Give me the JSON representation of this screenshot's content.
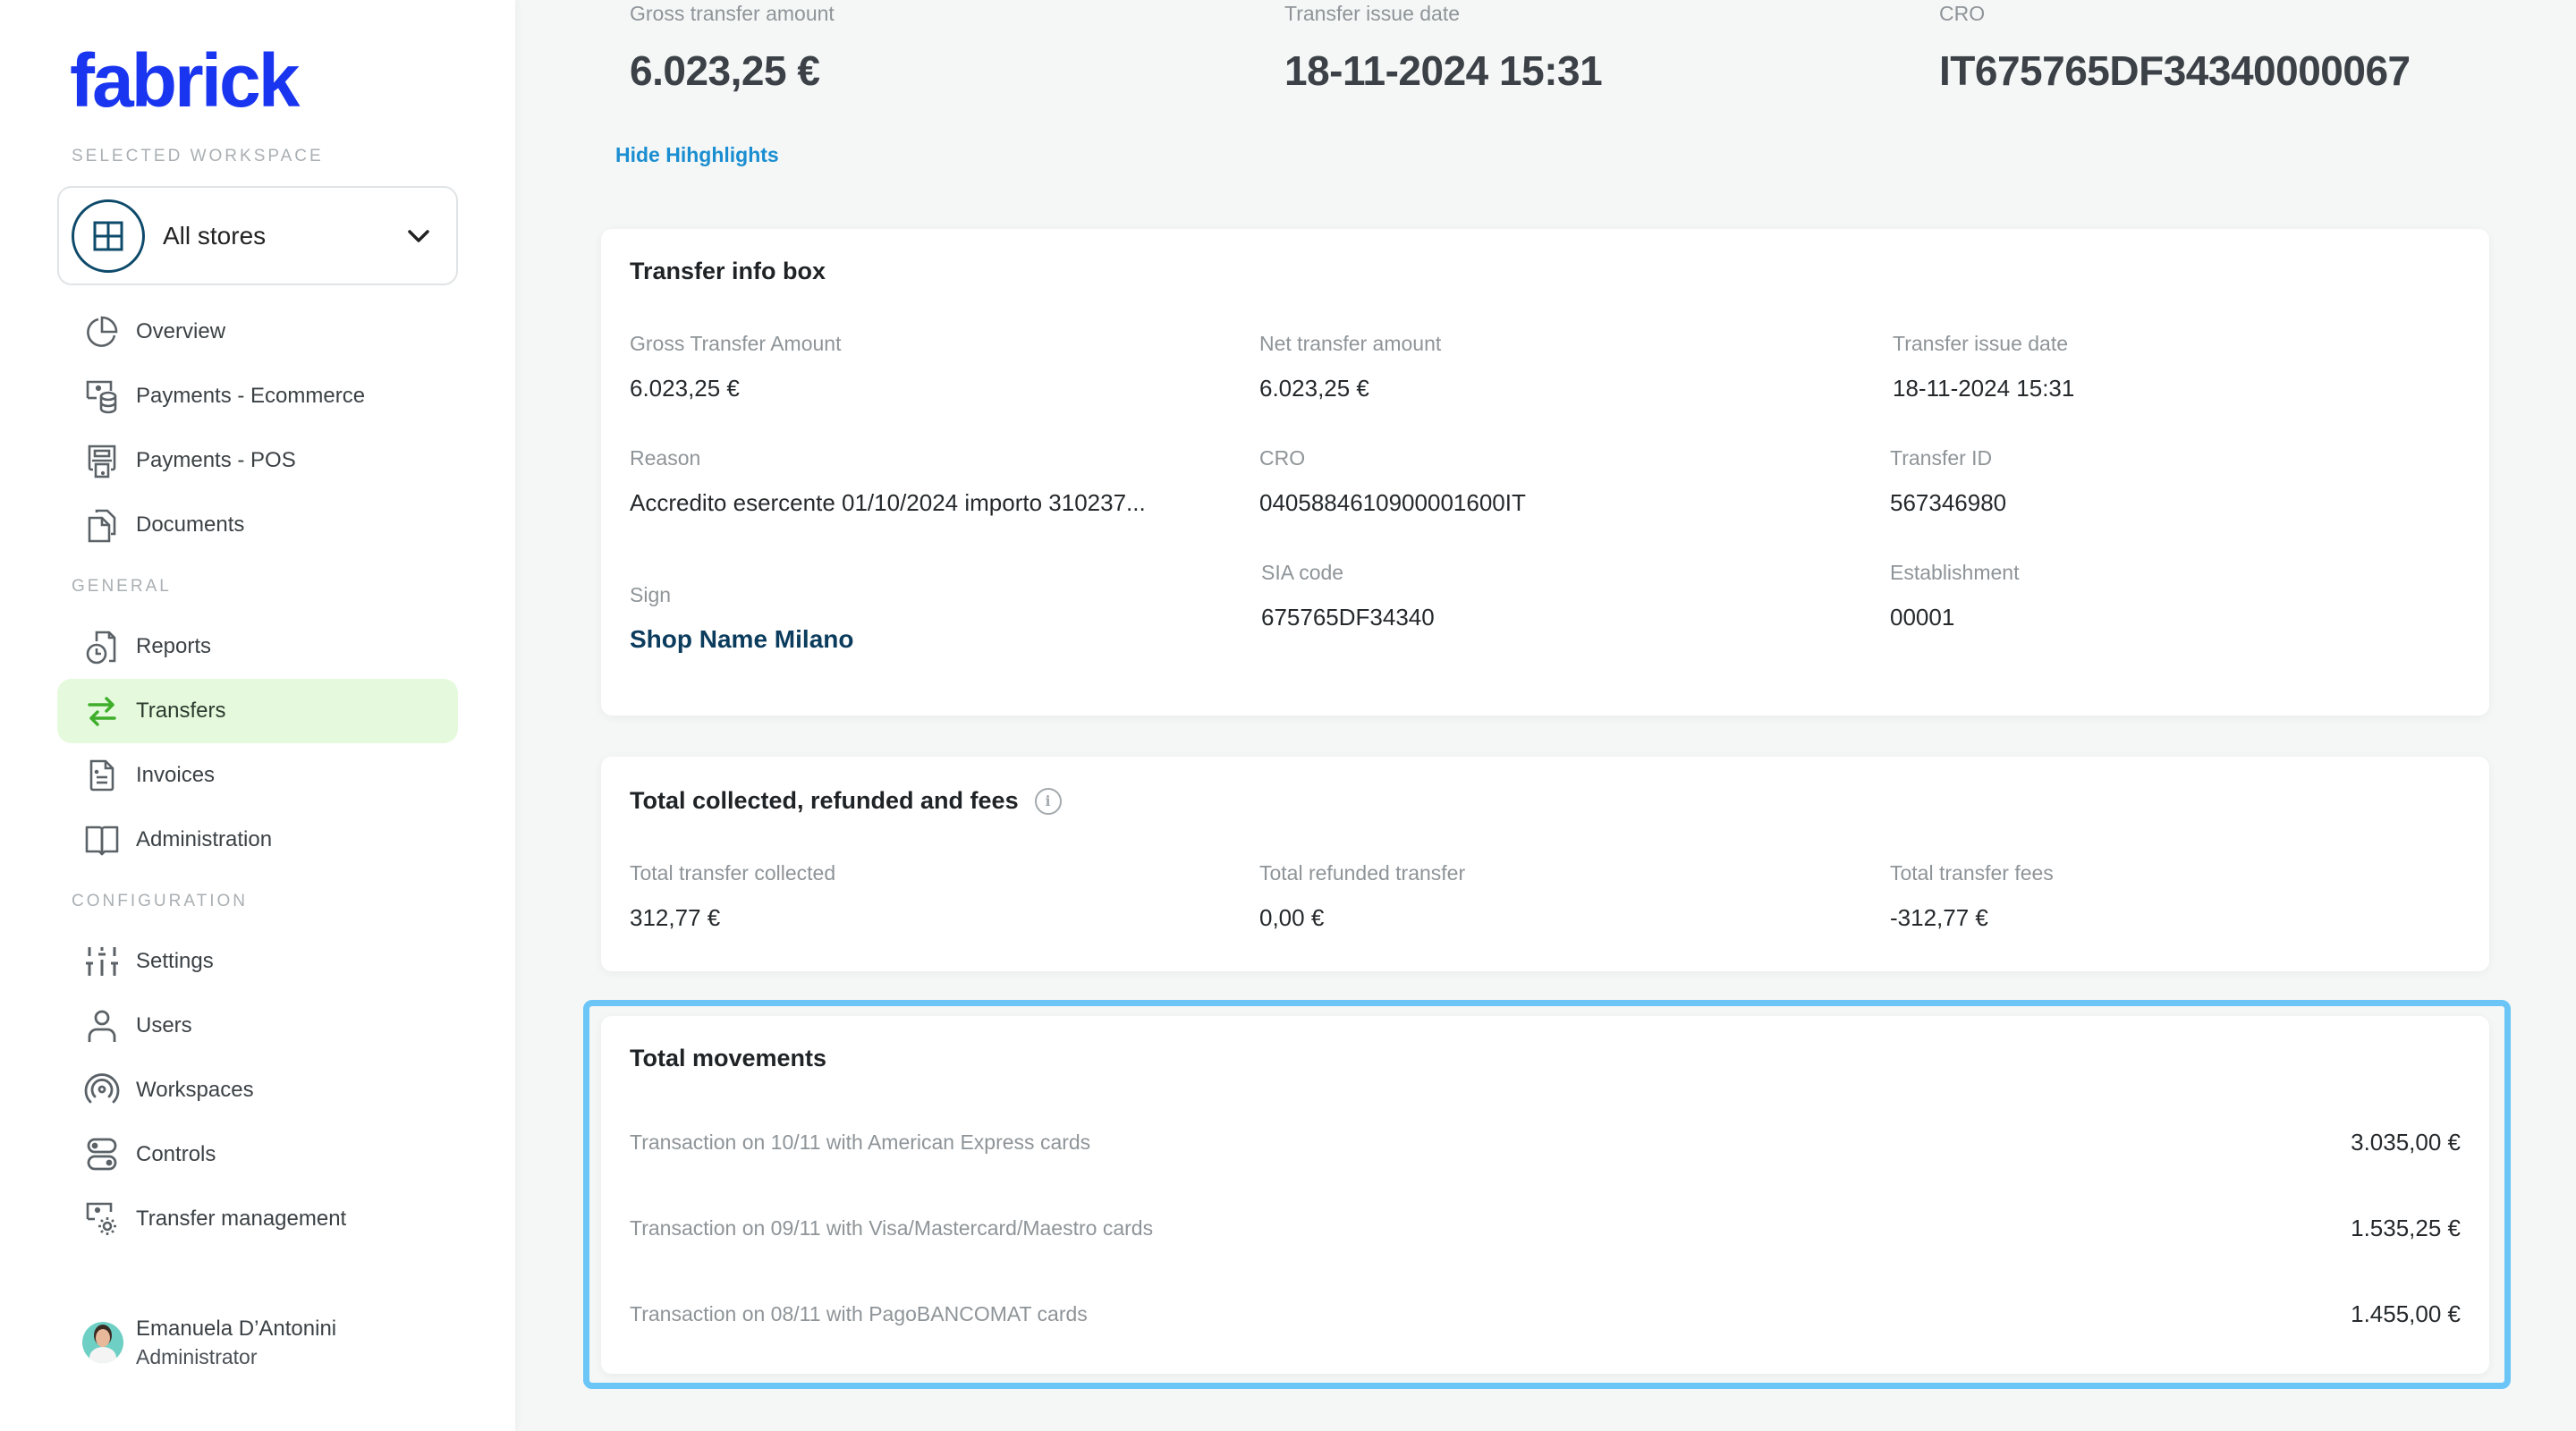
{
  "sidebar": {
    "logo": "fabrick",
    "workspace_section": "SELECTED WORKSPACE",
    "workspace": {
      "label": "All stores",
      "icon": "grid-icon"
    },
    "items_top": [
      {
        "label": "Overview",
        "icon": "pie-chart-icon"
      },
      {
        "label": "Payments - Ecommerce",
        "icon": "ecommerce-payments-icon"
      },
      {
        "label": "Payments - POS",
        "icon": "pos-terminal-icon"
      },
      {
        "label": "Documents",
        "icon": "documents-icon"
      }
    ],
    "general_section": "GENERAL",
    "items_general": [
      {
        "label": "Reports",
        "icon": "report-clock-icon"
      },
      {
        "label": "Transfers",
        "icon": "transfer-arrows-icon",
        "active": true
      },
      {
        "label": "Invoices",
        "icon": "invoice-icon"
      },
      {
        "label": "Administration",
        "icon": "book-icon"
      }
    ],
    "configuration_section": "CONFIGURATION",
    "items_config": [
      {
        "label": "Settings",
        "icon": "sliders-icon"
      },
      {
        "label": "Users",
        "icon": "user-icon"
      },
      {
        "label": "Workspaces",
        "icon": "broadcast-icon"
      },
      {
        "label": "Controls",
        "icon": "toggles-icon"
      },
      {
        "label": "Transfer management",
        "icon": "screen-gear-icon"
      }
    ],
    "user": {
      "name": "Emanuela D’Antonini",
      "role": "Administrator"
    }
  },
  "highlights": {
    "items": [
      {
        "label": "Gross transfer amount",
        "value": "6.023,25 €"
      },
      {
        "label": "Transfer issue date",
        "value": "18-11-2024 15:31"
      },
      {
        "label": "CRO",
        "value": "IT675765DF34340000067"
      }
    ],
    "hide_link": "Hide Hihghlights"
  },
  "transfer_info": {
    "title": "Transfer info box",
    "gross_label": "Gross Transfer Amount",
    "gross_value": "6.023,25 €",
    "net_label": "Net transfer amount",
    "net_value": "6.023,25 €",
    "date_label": "Transfer issue date",
    "date_value": "18-11-2024 15:31",
    "reason_label": "Reason",
    "reason_value": "Accredito esercente 01/10/2024 importo 310237...",
    "cro_label": "CRO",
    "cro_value": "0405884610900001600IT",
    "transfer_id_label": "Transfer ID",
    "transfer_id_value": "567346980",
    "sign_label": "Sign",
    "sign_value": "Shop Name Milano",
    "sia_label": "SIA code",
    "sia_value": "675765DF34340",
    "establishment_label": "Establishment",
    "establishment_value": "00001"
  },
  "totals": {
    "title": "Total collected, refunded and fees",
    "collected_label": "Total transfer collected",
    "collected_value": "312,77 €",
    "refunded_label": "Total refunded transfer",
    "refunded_value": "0,00 €",
    "fees_label": "Total transfer fees",
    "fees_value": "-312,77 €"
  },
  "movements": {
    "title": "Total movements",
    "rows": [
      {
        "label": "Transaction on 10/11 with American Express cards",
        "value": "3.035,00 €"
      },
      {
        "label": "Transaction on 09/11 with Visa/Mastercard/Maestro cards",
        "value": "1.535,25 €"
      },
      {
        "label": "Transaction on 08/11 with PagoBANCOMAT cards",
        "value": "1.455,00 €"
      }
    ]
  },
  "colors": {
    "brand": "#1a35f0",
    "active_nav_bg": "#e5fadd",
    "active_nav_icon": "#3fae2a",
    "link": "#1a8ed1",
    "highlight_border": "#6bc6f7"
  }
}
